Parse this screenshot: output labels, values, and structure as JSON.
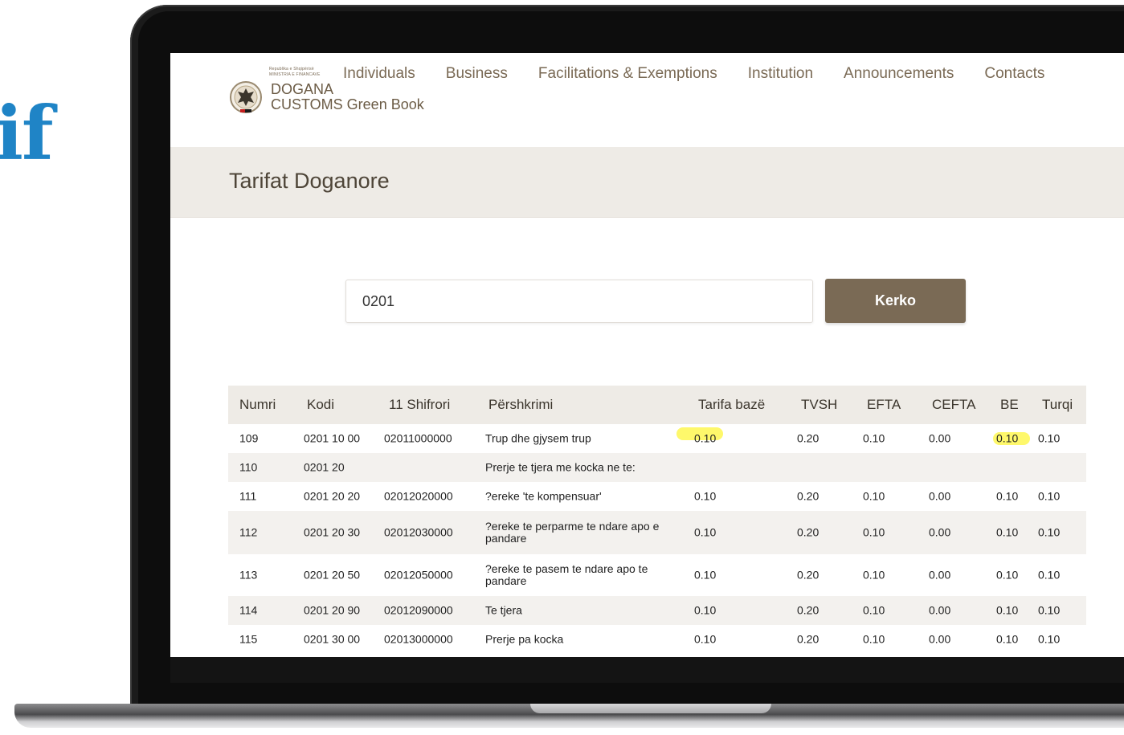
{
  "background_text": "if",
  "logo": {
    "tiny_line_1": "Republika e Shqipërisë",
    "tiny_line_2": "MINISTRIA E FINANCAVE",
    "line_1": "DOGANA",
    "line_2": "CUSTOMS Green Book"
  },
  "nav": [
    "Individuals",
    "Business",
    "Facilitations & Exemptions",
    "Institution",
    "Announcements",
    "Contacts"
  ],
  "page_title": "Tarifat Doganore",
  "search": {
    "value": "0201",
    "button_label": "Kerko"
  },
  "table": {
    "headers": [
      "Numri",
      "Kodi",
      "11 Shifrori",
      "Përshkrimi",
      "Tarifa bazë",
      "TVSH",
      "EFTA",
      "CEFTA",
      "BE",
      "Turqi"
    ],
    "rows": [
      [
        "109",
        "0201 10 00",
        "02011000000",
        "Trup dhe gjysem trup",
        "0.10",
        "0.20",
        "0.10",
        "0.00",
        "0.10",
        "0.10"
      ],
      [
        "110",
        "0201 20",
        "",
        "Prerje te tjera me kocka ne te:",
        "",
        "",
        "",
        "",
        "",
        ""
      ],
      [
        "111",
        "0201 20 20",
        "02012020000",
        "?ereke 'te kompensuar'",
        "0.10",
        "0.20",
        "0.10",
        "0.00",
        "0.10",
        "0.10"
      ],
      [
        "112",
        "0201 20 30",
        "02012030000",
        "?ereke te perparme te ndare apo e pandare",
        "0.10",
        "0.20",
        "0.10",
        "0.00",
        "0.10",
        "0.10"
      ],
      [
        "113",
        "0201 20 50",
        "02012050000",
        "?ereke te pasem te ndare apo te pandare",
        "0.10",
        "0.20",
        "0.10",
        "0.00",
        "0.10",
        "0.10"
      ],
      [
        "114",
        "0201 20 90",
        "02012090000",
        "Te tjera",
        "0.10",
        "0.20",
        "0.10",
        "0.00",
        "0.10",
        "0.10"
      ],
      [
        "115",
        "0201 30 00",
        "02013000000",
        "Prerje pa kocka",
        "0.10",
        "0.20",
        "0.10",
        "0.00",
        "0.10",
        "0.10"
      ]
    ]
  },
  "colors": {
    "brand": "#7a6a55",
    "band": "#eeebe6",
    "highlight": "#fdf53a",
    "background_text": "#1f84c6"
  },
  "icons": {
    "logo_emblem": "eagle-emblem-icon"
  }
}
